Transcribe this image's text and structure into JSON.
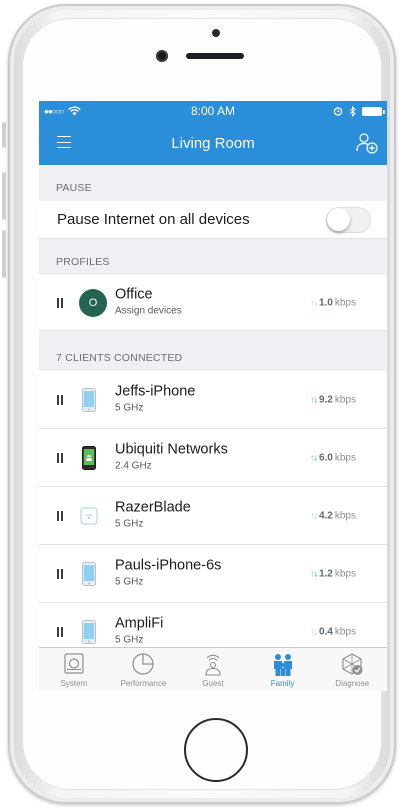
{
  "status_bar": {
    "carrier_dots": "●●○○○",
    "time": "8:00 AM"
  },
  "nav": {
    "title": "Living Room"
  },
  "pause_section": {
    "header": "PAUSE",
    "label": "Pause Internet on all devices",
    "toggle_on": false
  },
  "profiles_section": {
    "header": "PROFILES",
    "items": [
      {
        "initial": "O",
        "name": "Office",
        "sub": "Assign devices",
        "rate": "1.0",
        "unit": "kbps",
        "avatar_color": "#236455"
      }
    ]
  },
  "clients_section": {
    "header": "7 CLIENTS CONNECTED",
    "items": [
      {
        "name": "Jeffs-iPhone",
        "sub": "5 GHz",
        "rate": "9.2",
        "unit": "kbps",
        "icon": "iphone-icon"
      },
      {
        "name": "Ubiquiti Networks",
        "sub": "2.4 GHz",
        "rate": "6.0",
        "unit": "kbps",
        "icon": "android-phone-icon"
      },
      {
        "name": "RazerBlade",
        "sub": "5 GHz",
        "rate": "4.2",
        "unit": "kbps",
        "icon": "wifi-device-icon"
      },
      {
        "name": "Pauls-iPhone-6s",
        "sub": "5 GHz",
        "rate": "1.2",
        "unit": "kbps",
        "icon": "iphone-icon"
      },
      {
        "name": "AmpliFi",
        "sub": "5 GHz",
        "rate": "0.4",
        "unit": "kbps",
        "icon": "iphone-icon"
      }
    ]
  },
  "tabs": [
    {
      "label": "System",
      "icon": "system-icon",
      "active": false
    },
    {
      "label": "Performance",
      "icon": "performance-icon",
      "active": false
    },
    {
      "label": "Guest",
      "icon": "guest-icon",
      "active": false
    },
    {
      "label": "Family",
      "icon": "family-icon",
      "active": true
    },
    {
      "label": "Diagnose",
      "icon": "diagnose-icon",
      "active": false
    }
  ],
  "colors": {
    "accent": "#2a8ed8",
    "profile_avatar": "#236455"
  }
}
